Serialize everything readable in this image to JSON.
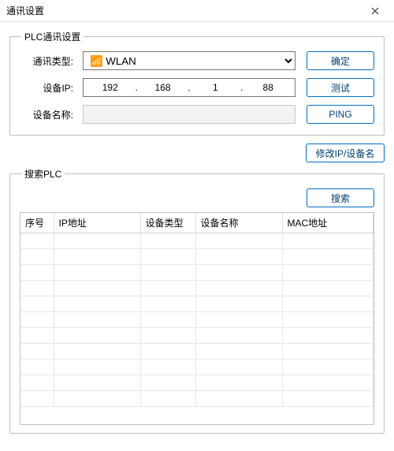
{
  "window": {
    "title": "通讯设置"
  },
  "plc_group": {
    "legend": "PLC通讯设置",
    "labels": {
      "comm_type": "通讯类型:",
      "device_ip": "设备IP:",
      "device_name": "设备名称:"
    },
    "comm_type_value": "WLAN",
    "ip": {
      "a": "192",
      "b": "168",
      "c": "1",
      "d": "88"
    },
    "device_name_value": "",
    "buttons": {
      "ok": "确定",
      "test": "测试",
      "ping": "PING"
    }
  },
  "actions": {
    "modify": "修改IP/设备名"
  },
  "search_group": {
    "legend": "搜索PLC",
    "search_btn": "搜索",
    "columns": {
      "seq": "序号",
      "ip": "IP地址",
      "type": "设备类型",
      "name": "设备名称",
      "mac": "MAC地址"
    },
    "rows": []
  }
}
